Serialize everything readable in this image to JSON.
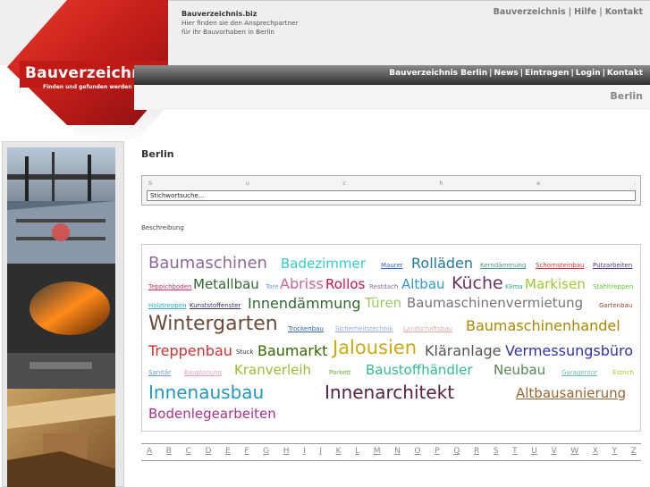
{
  "site": {
    "domain": "Bauverzeichnis.biz",
    "tagline_1": "Hier finden sie den Ansprechpartner",
    "tagline_2": "für ihr Bauvorhaben in Berlin",
    "logo_title": "Bauverzeichnis",
    "logo_sub": "Finden und gefunden werden"
  },
  "top_links": [
    "Bauverzeichnis",
    "Hilfe",
    "Kontakt"
  ],
  "nav_links": [
    "Bauverzeichnis Berlin",
    "News",
    "Eintragen",
    "Login",
    "Kontakt"
  ],
  "city_header": "Berlin",
  "main": {
    "title": "Berlin",
    "search_letters": [
      "S",
      "u",
      "c",
      "h",
      "e",
      ":"
    ],
    "search_placeholder": "Stichwortsuche...",
    "description_label": "Beschreibung"
  },
  "tags": [
    {
      "text": "Baumaschinen",
      "color": "#8a6a9a"
    },
    {
      "text": "Badezimmer",
      "color": "#33cccc"
    },
    {
      "text": "Maurer",
      "color": "#3366cc"
    },
    {
      "text": "Rolläden",
      "color": "#1f7a99"
    },
    {
      "text": "Kerndämmung",
      "color": "#4a9a88"
    },
    {
      "text": "Schornsteinbau",
      "color": "#cc3333"
    },
    {
      "text": "Putzarbeiten",
      "color": "#553388"
    },
    {
      "text": "Teppichboden",
      "color": "#cc3366"
    },
    {
      "text": "Metallbau",
      "color": "#336633"
    },
    {
      "text": "Tore",
      "color": "#6699cc"
    },
    {
      "text": "Abriss",
      "color": "#cc6699"
    },
    {
      "text": "Rollos",
      "color": "#cc1144"
    },
    {
      "text": "Restdach",
      "color": "#8a6a9a"
    },
    {
      "text": "Altbau",
      "color": "#3399cc"
    },
    {
      "text": "Küche",
      "color": "#663366"
    },
    {
      "text": "Klima",
      "color": "#33aa88"
    },
    {
      "text": "Markisen",
      "color": "#99cc33"
    },
    {
      "text": "Stahltreppen",
      "color": "#66cc33"
    },
    {
      "text": "Holztreppen",
      "color": "#33aacc"
    },
    {
      "text": "Kunststoffenster",
      "color": "#333366"
    },
    {
      "text": "Innendämmung",
      "color": "#336633"
    },
    {
      "text": "Türen",
      "color": "#99cc66"
    },
    {
      "text": "Baumaschinenvermietung",
      "color": "#777777"
    },
    {
      "text": "Gartenbau",
      "color": "#994433"
    },
    {
      "text": "Wintergarten",
      "color": "#6a4a3a"
    },
    {
      "text": "Trockenbau",
      "color": "#3366aa"
    },
    {
      "text": "Sicherheitstechnik",
      "color": "#99aadd"
    },
    {
      "text": "Landschaftsbau",
      "color": "#ddaaaa"
    },
    {
      "text": "Baumaschinenhandel",
      "color": "#aa8800"
    },
    {
      "text": "Treppenbau",
      "color": "#cc3333"
    },
    {
      "text": "Stuck",
      "color": "#333333"
    },
    {
      "text": "Baumarkt",
      "color": "#336600"
    },
    {
      "text": "Jalousien",
      "color": "#ccaa11"
    },
    {
      "text": "Kläranlage",
      "color": "#555555"
    },
    {
      "text": "Vermessungsbüro",
      "color": "#3333aa"
    },
    {
      "text": "Sanitär",
      "color": "#6699cc"
    },
    {
      "text": "Bauplanung",
      "color": "#ee99bb"
    },
    {
      "text": "Kranverleih",
      "color": "#99bb33"
    },
    {
      "text": "Parkett",
      "color": "#66aa33"
    },
    {
      "text": "Baustoffhändler",
      "color": "#33bb88"
    },
    {
      "text": "Neubau",
      "color": "#558855"
    },
    {
      "text": "Garagentor",
      "color": "#66bbaa"
    },
    {
      "text": "Estrich",
      "color": "#aacc22"
    },
    {
      "text": "Innenausbau",
      "color": "#2299bb"
    },
    {
      "text": "Innenarchitekt",
      "color": "#552244"
    },
    {
      "text": "Altbausanierung",
      "color": "#996633"
    },
    {
      "text": "Bodenlegearbeiten",
      "color": "#aa3388"
    }
  ],
  "alphabet": [
    "A",
    "B",
    "C",
    "D",
    "E",
    "F",
    "G",
    "H",
    "I",
    "J",
    "K",
    "L",
    "M",
    "N",
    "O",
    "P",
    "Q",
    "R",
    "S",
    "T",
    "U",
    "V",
    "W",
    "X",
    "Y",
    "Z"
  ]
}
